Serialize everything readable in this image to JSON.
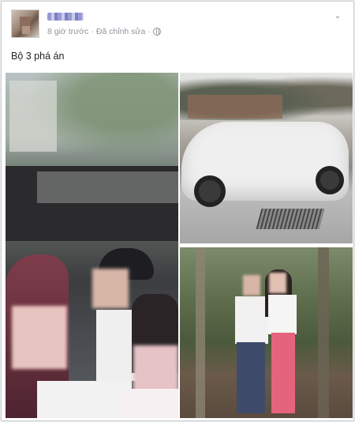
{
  "post": {
    "meta_time": "8 giờ trước",
    "meta_separator": "·",
    "meta_edited": "Đã chỉnh sửa",
    "text": "Bộ 3 phá án"
  },
  "icons": {
    "privacy": "globe-icon",
    "options": "chevron-down-icon"
  },
  "colors": {
    "meta_text": "#90949c",
    "body_text": "#1d2129",
    "card_border": "#c9ccd1",
    "background": "#e9ebee"
  }
}
